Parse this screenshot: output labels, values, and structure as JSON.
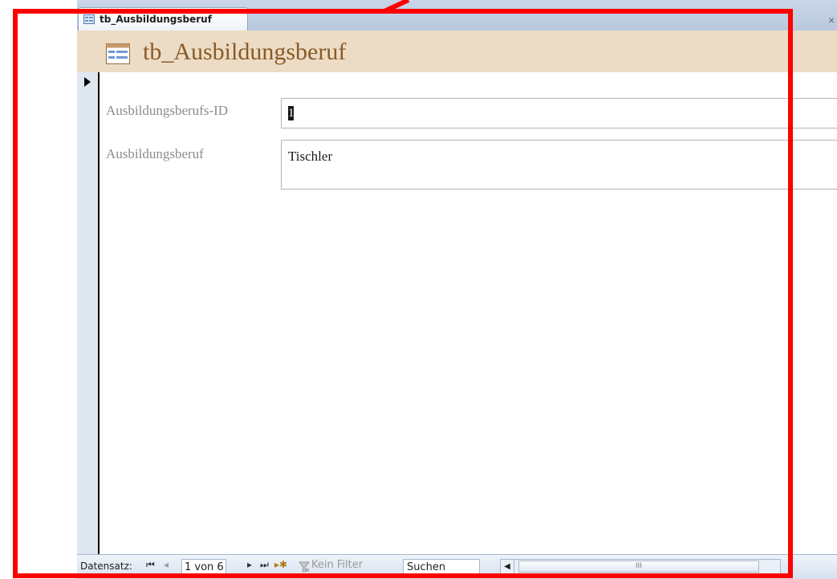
{
  "tab": {
    "title": "tb_Ausbildungsberuf",
    "close": "×"
  },
  "header": {
    "title": "tb_Ausbildungsberuf"
  },
  "fields": {
    "id_label": "Ausbildungsberufs-ID",
    "id_value": "1",
    "name_label": "Ausbildungsberuf",
    "name_value": "Tischler"
  },
  "navbar": {
    "record_label": "Datensatz:",
    "first": "⏮",
    "prev": "◂",
    "record_value": "1 von 6",
    "next": "▸",
    "last": "⏭",
    "new": "▸✱",
    "filter_label": "Kein Filter",
    "search_value": "Suchen",
    "scroll_left": "◀",
    "scroll_thumb": "III"
  },
  "colors": {
    "highlight": "#ff0000",
    "header_bg": "#ecdcc5",
    "title": "#8a5a26"
  }
}
